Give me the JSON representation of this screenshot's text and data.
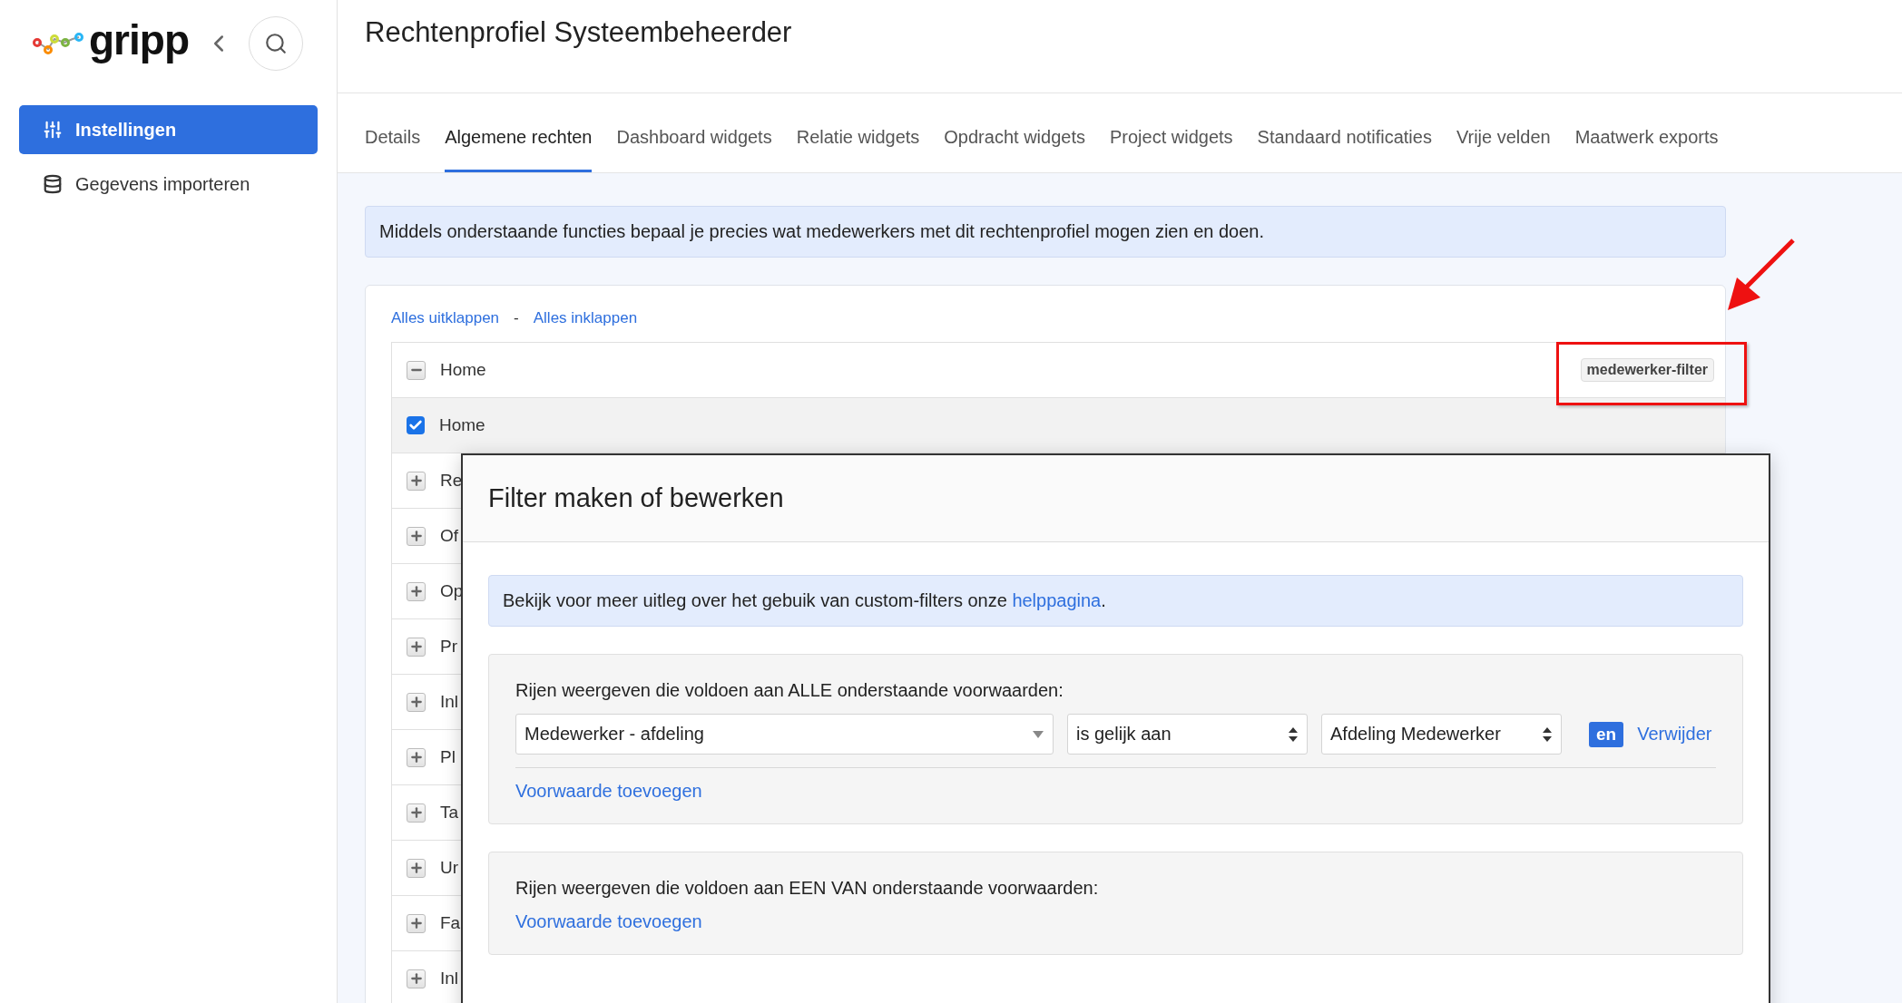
{
  "sidebar": {
    "logo": "gripp",
    "items": [
      {
        "label": "Instellingen",
        "selected": true
      },
      {
        "label": "Gegevens importeren",
        "selected": false
      }
    ]
  },
  "page": {
    "title": "Rechtenprofiel Systeembeheerder"
  },
  "tabs": [
    {
      "label": "Details",
      "selected": false
    },
    {
      "label": "Algemene rechten",
      "selected": true
    },
    {
      "label": "Dashboard widgets",
      "selected": false
    },
    {
      "label": "Relatie widgets",
      "selected": false
    },
    {
      "label": "Opdracht widgets",
      "selected": false
    },
    {
      "label": "Project widgets",
      "selected": false
    },
    {
      "label": "Standaard notificaties",
      "selected": false
    },
    {
      "label": "Vrije velden",
      "selected": false
    },
    {
      "label": "Maatwerk exports",
      "selected": false
    }
  ],
  "info": "Middels onderstaande functies bepaal je precies wat medewerkers met dit rechtenprofiel mogen zien en doen.",
  "tree": {
    "expand_all": "Alles uitklappen",
    "separator": "-",
    "collapse_all": "Alles inklappen",
    "rows": [
      {
        "label": "Home",
        "expanded": true,
        "tag": "medewerker-filter",
        "children": [
          {
            "label": "Home",
            "checked": true
          }
        ]
      },
      {
        "label": "Re",
        "expanded": false
      },
      {
        "label": "Of",
        "expanded": false
      },
      {
        "label": "Op",
        "expanded": false
      },
      {
        "label": "Pr",
        "expanded": false
      },
      {
        "label": "Inl",
        "expanded": false
      },
      {
        "label": "Pl",
        "expanded": false
      },
      {
        "label": "Ta",
        "expanded": false
      },
      {
        "label": "Ur",
        "expanded": false
      },
      {
        "label": "Fa",
        "expanded": false
      },
      {
        "label": "Inl",
        "expanded": false
      }
    ]
  },
  "modal": {
    "title": "Filter maken of bewerken",
    "info_text": "Bekijk voor meer uitleg over het gebuik van custom-filters onze ",
    "info_link": "helppagina",
    "info_end": ".",
    "sections": [
      {
        "label": "Rijen weergeven die voldoen aan ALLE onderstaande voorwaarden:",
        "conditions": [
          {
            "inputs": [
              {
                "kind": "combobox",
                "value": "Medewerker - afdeling"
              },
              {
                "kind": "select",
                "value": "is gelijk aan"
              },
              {
                "kind": "select",
                "value": "Afdeling Medewerker"
              }
            ],
            "connector": "en",
            "remove": "Verwijder"
          }
        ],
        "add": "Voorwaarde toevoegen"
      },
      {
        "label": "Rijen weergeven die voldoen aan EEN VAN onderstaande voorwaarden:",
        "add": "Voorwaarde toevoegen"
      }
    ]
  }
}
